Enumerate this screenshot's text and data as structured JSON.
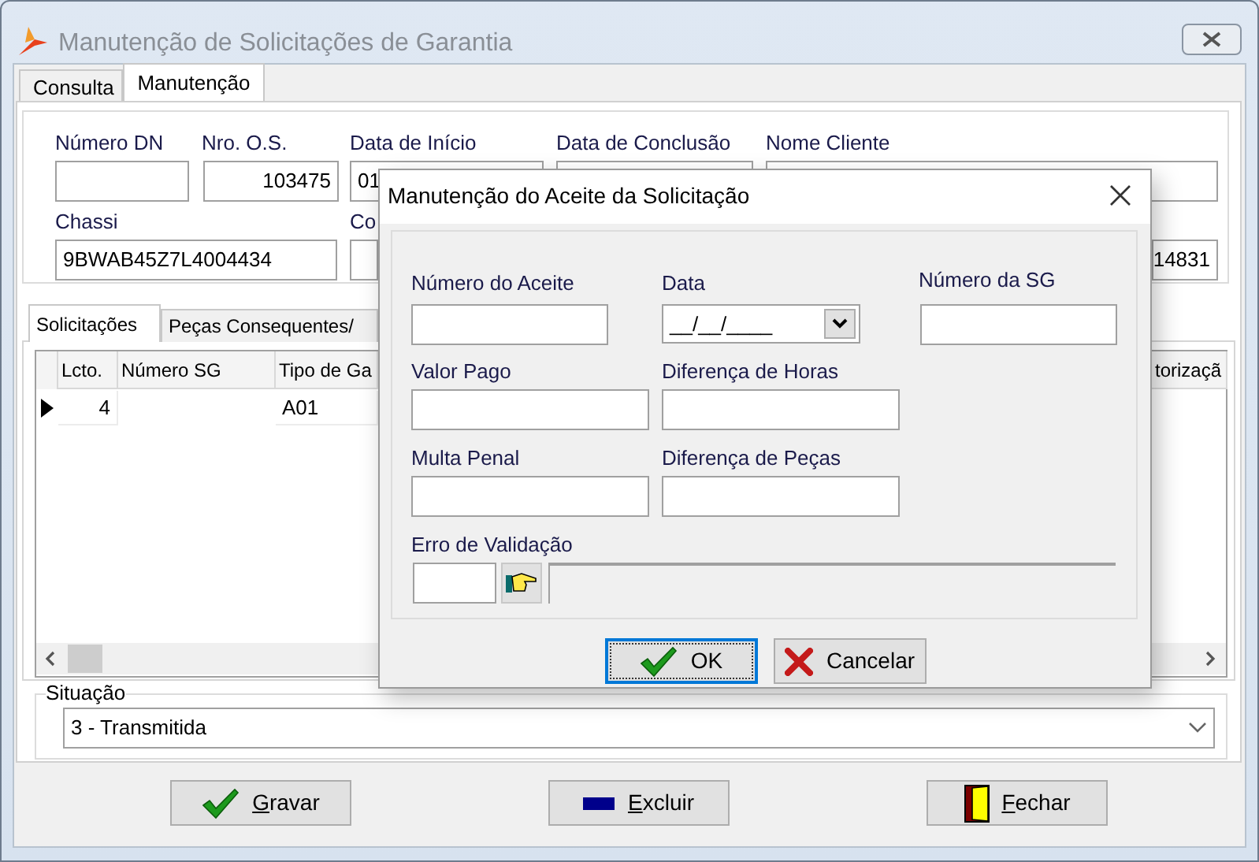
{
  "window": {
    "title": "Manutenção de Solicitações de Garantia"
  },
  "tabs": [
    {
      "label": "Consulta",
      "selected": false
    },
    {
      "label": "Manutenção",
      "selected": true
    }
  ],
  "header_fields": [
    {
      "label": "Número DN"
    },
    {
      "label": "Nro. O.S.",
      "value": "103475"
    },
    {
      "label": "Data de Início",
      "value": "01"
    },
    {
      "label": "Data de Conclusão"
    },
    {
      "label": "Nome Cliente"
    },
    {
      "label": "Chassi",
      "value": "9BWAB45Z7L4004434"
    },
    {
      "label": "Co"
    },
    {
      "value": "14831"
    }
  ],
  "detail_tabs": [
    {
      "label": "Solicitações",
      "selected": true
    },
    {
      "label": "Peças Consequentes/",
      "selected": false
    }
  ],
  "table": {
    "columns": [
      "Lcto.",
      "Número SG",
      "Tipo de Ga",
      "torizaçã"
    ],
    "rows": [
      {
        "selected": true,
        "cells": [
          "4",
          "",
          "A01"
        ]
      }
    ]
  },
  "situacao": {
    "label": "Situação",
    "value": "3 - Transmitida"
  },
  "buttons": [
    {
      "kind": "save",
      "label": "Gravar"
    },
    {
      "kind": "delete",
      "label": "Excluir"
    },
    {
      "kind": "close",
      "label": "Fechar"
    }
  ],
  "dialog": {
    "title": "Manutenção do Aceite da Solicitação",
    "numero_aceite": {
      "label": "Número do Aceite"
    },
    "data": {
      "label": "Data",
      "value": "__/__/____"
    },
    "numero_sg": {
      "label": "Número da SG"
    },
    "valor_pago": {
      "label": "Valor Pago"
    },
    "diferenca_horas": {
      "label": "Diferença de Horas"
    },
    "multa_penal": {
      "label": "Multa Penal"
    },
    "diferenca_pecas": {
      "label": "Diferença de Peças"
    },
    "erro_validacao": {
      "label": "Erro de Validação"
    },
    "buttons": [
      {
        "kind": "ok",
        "label": "OK",
        "focused": true
      },
      {
        "kind": "cancel",
        "label": "Cancelar",
        "focused": false
      }
    ]
  }
}
